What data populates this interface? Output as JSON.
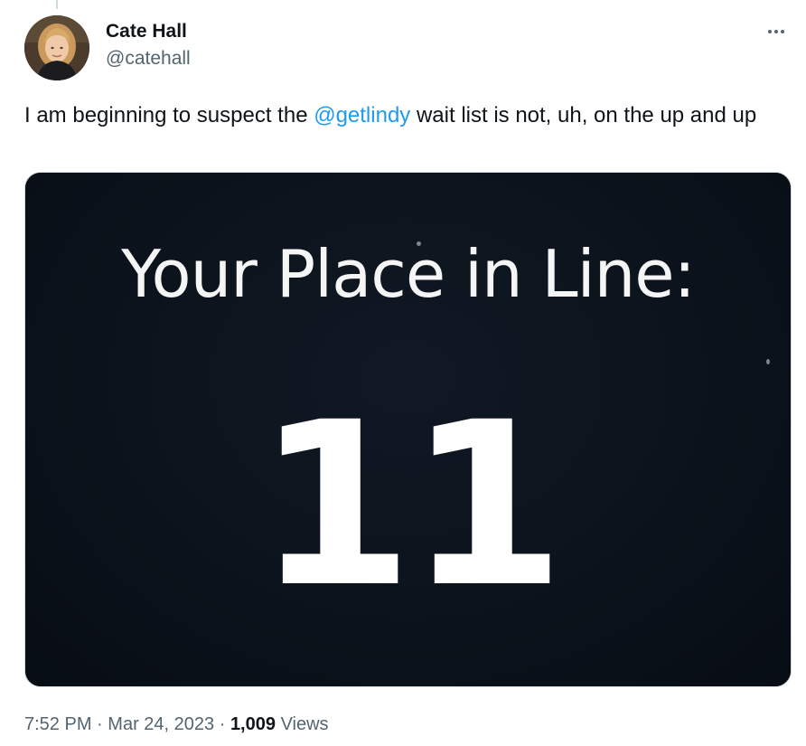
{
  "author": {
    "display_name": "Cate Hall",
    "handle": "@catehall"
  },
  "tweet": {
    "text_before": "I am beginning to suspect the ",
    "mention": "@getlindy",
    "text_after": " wait list is not, uh, on the up and up"
  },
  "media": {
    "heading": "Your Place in Line:",
    "number": "11"
  },
  "meta": {
    "time": "7:52 PM",
    "separator": "·",
    "date": "Mar 24, 2023",
    "views_count": "1,009",
    "views_label": "Views"
  },
  "icons": {
    "more": "more-horizontal-icon"
  },
  "colors": {
    "link": "#1d9bf0",
    "secondary_text": "#536471",
    "primary_text": "#0f1419",
    "media_background": "#0b111a"
  }
}
